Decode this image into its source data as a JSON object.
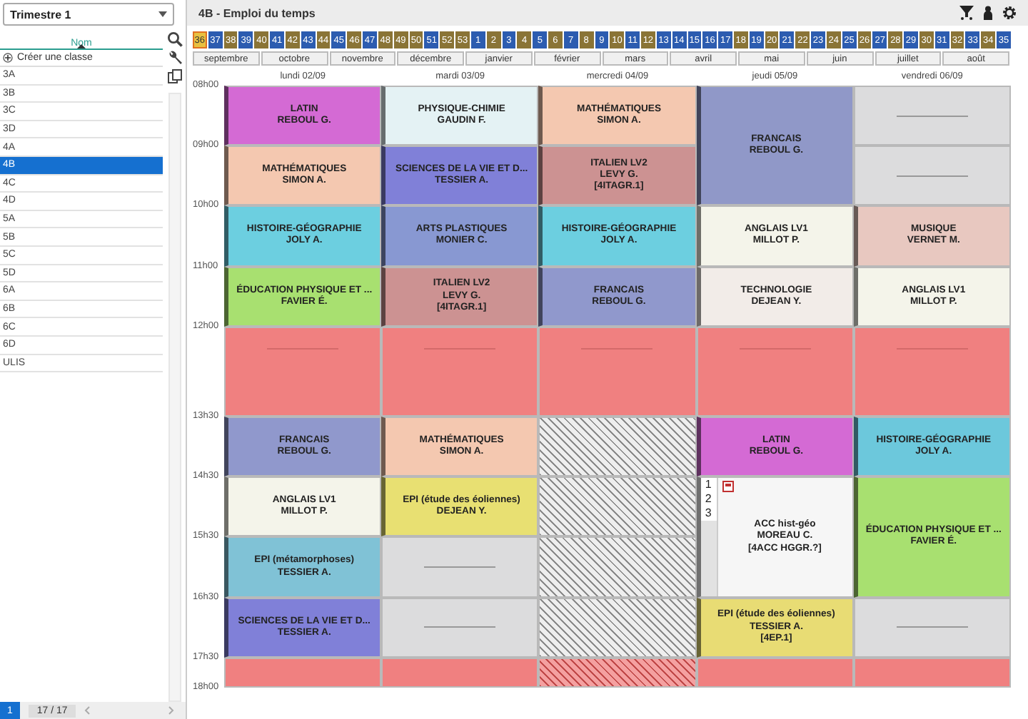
{
  "sidebar": {
    "period": "Trimestre 1",
    "column_header": "Nom",
    "create_label": "Créer une classe",
    "classes": [
      {
        "label": "3A",
        "selected": false
      },
      {
        "label": "3B",
        "selected": false
      },
      {
        "label": "3C",
        "selected": false
      },
      {
        "label": "3D",
        "selected": false
      },
      {
        "label": "4A",
        "selected": false
      },
      {
        "label": "4B",
        "selected": true
      },
      {
        "label": "4C",
        "selected": false
      },
      {
        "label": "4D",
        "selected": false
      },
      {
        "label": "5A",
        "selected": false
      },
      {
        "label": "5B",
        "selected": false
      },
      {
        "label": "5C",
        "selected": false
      },
      {
        "label": "5D",
        "selected": false
      },
      {
        "label": "6A",
        "selected": false
      },
      {
        "label": "6B",
        "selected": false
      },
      {
        "label": "6C",
        "selected": false
      },
      {
        "label": "6D",
        "selected": false
      },
      {
        "label": "ULIS",
        "selected": false
      }
    ],
    "page": "1",
    "count": "17 / 17"
  },
  "title": "4B - Emploi du temps",
  "weeks": [
    {
      "label": "36",
      "color": "#e8c040",
      "selected": true
    },
    {
      "label": "37",
      "color": "#2c5cb0",
      "selected": false
    },
    {
      "label": "38",
      "color": "#8a7436",
      "selected": false
    },
    {
      "label": "39",
      "color": "#2c5cb0",
      "selected": false
    },
    {
      "label": "40",
      "color": "#8a7436",
      "selected": false
    },
    {
      "label": "41",
      "color": "#2c5cb0",
      "selected": false
    },
    {
      "label": "42",
      "color": "#8a7436",
      "selected": false
    },
    {
      "label": "43",
      "color": "#2c5cb0",
      "selected": false
    },
    {
      "label": "44",
      "color": "#8a7436",
      "selected": false
    },
    {
      "label": "45",
      "color": "#2c5cb0",
      "selected": false
    },
    {
      "label": "46",
      "color": "#8a7436",
      "selected": false
    },
    {
      "label": "47",
      "color": "#2c5cb0",
      "selected": false
    },
    {
      "label": "48",
      "color": "#8a7436",
      "selected": false
    },
    {
      "label": "49",
      "color": "#8a7436",
      "selected": false
    },
    {
      "label": "50",
      "color": "#8a7436",
      "selected": false
    },
    {
      "label": "51",
      "color": "#2c5cb0",
      "selected": false
    },
    {
      "label": "52",
      "color": "#8a7436",
      "selected": false
    },
    {
      "label": "53",
      "color": "#8a7436",
      "selected": false
    },
    {
      "label": "1",
      "color": "#2c5cb0",
      "selected": false
    },
    {
      "label": "2",
      "color": "#8a7436",
      "selected": false
    },
    {
      "label": "3",
      "color": "#2c5cb0",
      "selected": false
    },
    {
      "label": "4",
      "color": "#8a7436",
      "selected": false
    },
    {
      "label": "5",
      "color": "#2c5cb0",
      "selected": false
    },
    {
      "label": "6",
      "color": "#8a7436",
      "selected": false
    },
    {
      "label": "7",
      "color": "#2c5cb0",
      "selected": false
    },
    {
      "label": "8",
      "color": "#8a7436",
      "selected": false
    },
    {
      "label": "9",
      "color": "#2c5cb0",
      "selected": false
    },
    {
      "label": "10",
      "color": "#8a7436",
      "selected": false
    },
    {
      "label": "11",
      "color": "#2c5cb0",
      "selected": false
    },
    {
      "label": "12",
      "color": "#8a7436",
      "selected": false
    },
    {
      "label": "13",
      "color": "#2c5cb0",
      "selected": false
    },
    {
      "label": "14",
      "color": "#2c5cb0",
      "selected": false
    },
    {
      "label": "15",
      "color": "#2c5cb0",
      "selected": false
    },
    {
      "label": "16",
      "color": "#2c5cb0",
      "selected": false
    },
    {
      "label": "17",
      "color": "#2c5cb0",
      "selected": false
    },
    {
      "label": "18",
      "color": "#8a7436",
      "selected": false
    },
    {
      "label": "19",
      "color": "#2c5cb0",
      "selected": false
    },
    {
      "label": "20",
      "color": "#8a7436",
      "selected": false
    },
    {
      "label": "21",
      "color": "#2c5cb0",
      "selected": false
    },
    {
      "label": "22",
      "color": "#8a7436",
      "selected": false
    },
    {
      "label": "23",
      "color": "#2c5cb0",
      "selected": false
    },
    {
      "label": "24",
      "color": "#8a7436",
      "selected": false
    },
    {
      "label": "25",
      "color": "#2c5cb0",
      "selected": false
    },
    {
      "label": "26",
      "color": "#8a7436",
      "selected": false
    },
    {
      "label": "27",
      "color": "#2c5cb0",
      "selected": false
    },
    {
      "label": "28",
      "color": "#8a7436",
      "selected": false
    },
    {
      "label": "29",
      "color": "#2c5cb0",
      "selected": false
    },
    {
      "label": "30",
      "color": "#8a7436",
      "selected": false
    },
    {
      "label": "31",
      "color": "#2c5cb0",
      "selected": false
    },
    {
      "label": "32",
      "color": "#8a7436",
      "selected": false
    },
    {
      "label": "33",
      "color": "#2c5cb0",
      "selected": false
    },
    {
      "label": "34",
      "color": "#8a7436",
      "selected": false
    },
    {
      "label": "35",
      "color": "#2c5cb0",
      "selected": false
    }
  ],
  "months": [
    "septembre",
    "octobre",
    "novembre",
    "décembre",
    "janvier",
    "février",
    "mars",
    "avril",
    "mai",
    "juin",
    "juillet",
    "août"
  ],
  "times": [
    "08h00",
    "09h00",
    "10h00",
    "11h00",
    "12h00",
    "13h30",
    "14h30",
    "15h30",
    "16h30",
    "17h30",
    "18h00"
  ],
  "days": [
    {
      "label": "lundi 02/09",
      "slots": [
        {
          "kind": "lesson",
          "double": false,
          "subject": "LATIN",
          "teacher": "REBOUL G.",
          "color": "#d46ad4"
        },
        {
          "kind": "lesson",
          "double": false,
          "subject": "MATHÉMATIQUES",
          "teacher": "SIMON A.",
          "color": "#f4c8b0"
        },
        {
          "kind": "lesson",
          "double": false,
          "subject": "HISTOIRE-GÉOGRAPHIE",
          "teacher": "JOLY A.",
          "color": "#6ccfe0"
        },
        {
          "kind": "lesson",
          "double": false,
          "subject": "ÉDUCATION PHYSIQUE ET ...",
          "teacher": "FAVIER É.",
          "color": "#a8e070"
        },
        {
          "kind": "break",
          "double": false
        },
        {
          "kind": "lesson",
          "double": false,
          "subject": "FRANCAIS",
          "teacher": "REBOUL G.",
          "color": "#9098cc"
        },
        {
          "kind": "lesson",
          "double": false,
          "subject": "ANGLAIS LV1",
          "teacher": "MILLOT P.",
          "color": "#f4f4ea"
        },
        {
          "kind": "lesson",
          "double": false,
          "subject": "EPI (métamorphoses)",
          "teacher": "TESSIER A.",
          "color": "#80c2d6"
        },
        {
          "kind": "lesson",
          "double": false,
          "subject": "SCIENCES DE LA VIE ET D...",
          "teacher": "TESSIER A.",
          "color": "#8080d8"
        },
        {
          "kind": "break",
          "double": false
        }
      ]
    },
    {
      "label": "mardi 03/09",
      "slots": [
        {
          "kind": "lesson",
          "double": false,
          "subject": "PHYSIQUE-CHIMIE",
          "teacher": "GAUDIN F.",
          "color": "#e4f2f4"
        },
        {
          "kind": "lesson",
          "double": false,
          "subject": "SCIENCES DE LA VIE ET D...",
          "teacher": "TESSIER A.",
          "color": "#8080d8"
        },
        {
          "kind": "lesson",
          "double": false,
          "subject": "ARTS PLASTIQUES",
          "teacher": "MONIER C.",
          "color": "#8898d2"
        },
        {
          "kind": "lesson",
          "double": false,
          "subject": "ITALIEN LV2",
          "teacher": "LEVY G.",
          "group": "[4ITAGR.1]",
          "color": "#cc9292"
        },
        {
          "kind": "break",
          "double": false
        },
        {
          "kind": "lesson",
          "double": false,
          "subject": "MATHÉMATIQUES",
          "teacher": "SIMON A.",
          "color": "#f4c8b0"
        },
        {
          "kind": "lesson",
          "double": false,
          "subject": "EPI (étude des éoliennes)",
          "teacher": "DEJEAN Y.",
          "color": "#e8e072"
        },
        {
          "kind": "empty",
          "double": false
        },
        {
          "kind": "empty",
          "double": false
        },
        {
          "kind": "break",
          "double": false
        }
      ]
    },
    {
      "label": "mercredi 04/09",
      "slots": [
        {
          "kind": "lesson",
          "double": false,
          "subject": "MATHÉMATIQUES",
          "teacher": "SIMON A.",
          "color": "#f4c8b0"
        },
        {
          "kind": "lesson",
          "double": false,
          "subject": "ITALIEN LV2",
          "teacher": "LEVY G.",
          "group": "[4ITAGR.1]",
          "color": "#cc9292"
        },
        {
          "kind": "lesson",
          "double": false,
          "subject": "HISTOIRE-GÉOGRAPHIE",
          "teacher": "JOLY A.",
          "color": "#6ccfe0"
        },
        {
          "kind": "lesson",
          "double": false,
          "subject": "FRANCAIS",
          "teacher": "REBOUL G.",
          "color": "#9098cc"
        },
        {
          "kind": "break",
          "double": false
        },
        {
          "kind": "closed",
          "double": false
        },
        {
          "kind": "closed",
          "double": false
        },
        {
          "kind": "closed",
          "double": false
        },
        {
          "kind": "closed",
          "double": false
        },
        {
          "kind": "closedbreak",
          "double": false
        }
      ]
    },
    {
      "label": "jeudi 05/09",
      "slots": [
        {
          "kind": "lesson",
          "double": true,
          "subject": "FRANCAIS",
          "teacher": "REBOUL G.",
          "color": "#9098c8"
        },
        {
          "kind": "lesson",
          "double": false,
          "subject": "ANGLAIS LV1",
          "teacher": "MILLOT P.",
          "color": "#f4f4ea"
        },
        {
          "kind": "lesson",
          "double": false,
          "subject": "TECHNOLOGIE",
          "teacher": "DEJEAN Y.",
          "color": "#f2ece8"
        },
        {
          "kind": "break",
          "double": false
        },
        {
          "kind": "lesson",
          "double": false,
          "subject": "LATIN",
          "teacher": "REBOUL G.",
          "color": "#d46ad4"
        },
        {
          "kind": "lesson",
          "double": true,
          "subject": "ACC hist-géo",
          "teacher": "MOREAU C.",
          "group": "[4ACC HGGR.?]",
          "color": "#f6f6f6",
          "groups": [
            "1",
            "2",
            "3"
          ]
        },
        {
          "kind": "lesson",
          "double": false,
          "subject": "EPI (étude des éoliennes)",
          "teacher": "TESSIER A.",
          "group": "[4EP.1]",
          "color": "#e8dc74"
        },
        {
          "kind": "break",
          "double": false
        }
      ]
    },
    {
      "label": "vendredi 06/09",
      "slots": [
        {
          "kind": "empty",
          "double": false
        },
        {
          "kind": "empty",
          "double": false
        },
        {
          "kind": "lesson",
          "double": false,
          "subject": "MUSIQUE",
          "teacher": "VERNET M.",
          "color": "#e8c8c0"
        },
        {
          "kind": "lesson",
          "double": false,
          "subject": "ANGLAIS LV1",
          "teacher": "MILLOT P.",
          "color": "#f4f4ea"
        },
        {
          "kind": "break",
          "double": false
        },
        {
          "kind": "lesson",
          "double": false,
          "subject": "HISTOIRE-GÉOGRAPHIE",
          "teacher": "JOLY A.",
          "color": "#6cc8dc"
        },
        {
          "kind": "lesson",
          "double": true,
          "subject": "ÉDUCATION PHYSIQUE ET ...",
          "teacher": "FAVIER É.",
          "color": "#a8e070"
        },
        {
          "kind": "empty",
          "double": false
        },
        {
          "kind": "break",
          "double": false
        }
      ]
    }
  ]
}
